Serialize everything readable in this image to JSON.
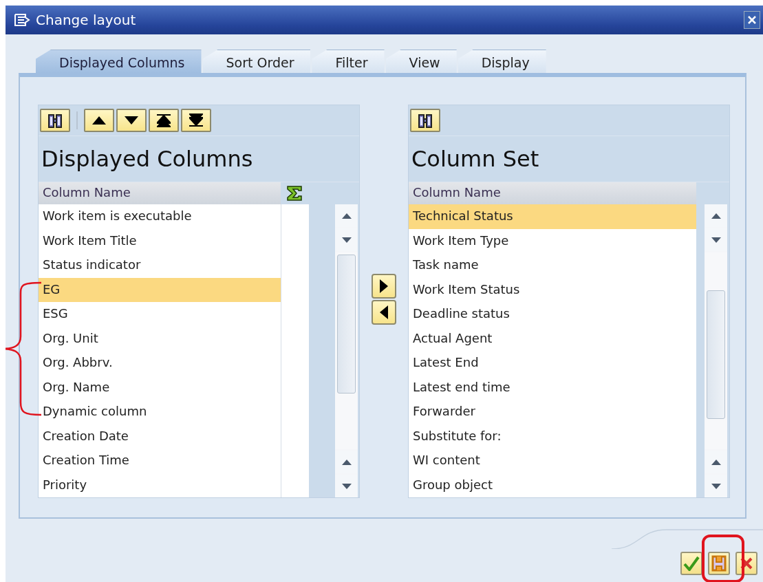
{
  "window": {
    "title": "Change layout"
  },
  "tabs": [
    {
      "label": "Displayed Columns",
      "selected": true
    },
    {
      "label": "Sort Order",
      "selected": false
    },
    {
      "label": "Filter",
      "selected": false
    },
    {
      "label": "View",
      "selected": false
    },
    {
      "label": "Display",
      "selected": false
    }
  ],
  "displayed_columns": {
    "title": "Displayed Columns",
    "header": "Column Name",
    "rows": [
      {
        "label": "Work item is executable",
        "selected": false
      },
      {
        "label": "Work Item Title",
        "selected": false
      },
      {
        "label": "Status indicator",
        "selected": false
      },
      {
        "label": "EG",
        "selected": true
      },
      {
        "label": "ESG",
        "selected": false
      },
      {
        "label": "Org. Unit",
        "selected": false
      },
      {
        "label": "Org. Abbrv.",
        "selected": false
      },
      {
        "label": "Org. Name",
        "selected": false
      },
      {
        "label": "Dynamic column",
        "selected": false
      },
      {
        "label": "Creation Date",
        "selected": false
      },
      {
        "label": "Creation Time",
        "selected": false
      },
      {
        "label": "Priority",
        "selected": false
      }
    ]
  },
  "column_set": {
    "title": "Column Set",
    "header": "Column Name",
    "rows": [
      {
        "label": "Technical Status",
        "selected": true
      },
      {
        "label": "Work Item Type",
        "selected": false
      },
      {
        "label": "Task name",
        "selected": false
      },
      {
        "label": "Work Item Status",
        "selected": false
      },
      {
        "label": "Deadline status",
        "selected": false
      },
      {
        "label": "Actual Agent",
        "selected": false
      },
      {
        "label": "Latest End",
        "selected": false
      },
      {
        "label": "Latest end time",
        "selected": false
      },
      {
        "label": "Forwarder",
        "selected": false
      },
      {
        "label": "Substitute for:",
        "selected": false
      },
      {
        "label": "WI content",
        "selected": false
      },
      {
        "label": "Group object",
        "selected": false
      }
    ]
  }
}
